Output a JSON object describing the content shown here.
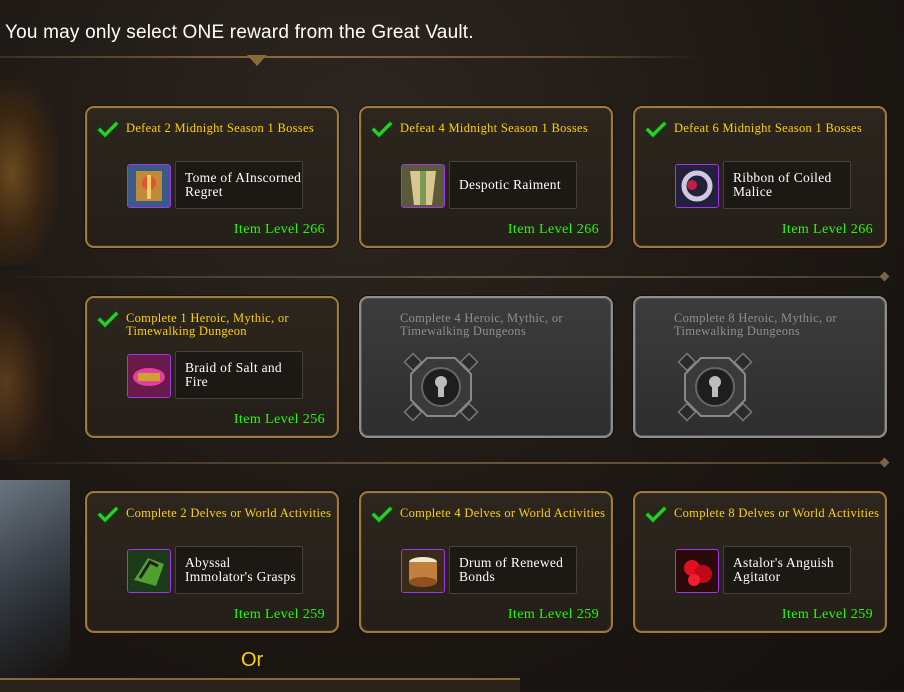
{
  "header": {
    "text": "You may only select ONE reward from the Great Vault."
  },
  "rows": [
    {
      "cards": [
        {
          "title": "Defeat 2 Midnight Season 1 Bosses",
          "item_name": "Tome of AInscorned Regret",
          "item_level": "Item Level 266",
          "icon": "tome-icon"
        },
        {
          "title": "Defeat 4 Midnight Season 1 Bosses",
          "item_name": "Despotic Raiment",
          "item_level": "Item Level 266",
          "icon": "robe-icon"
        },
        {
          "title": "Defeat 6 Midnight Season 1 Bosses",
          "item_name": "Ribbon of Coiled Malice",
          "item_level": "Item Level 266",
          "icon": "ring-icon"
        }
      ]
    },
    {
      "cards": [
        {
          "title": "Complete 1 Heroic, Mythic, or Timewalking Dungeon",
          "item_name": "Braid of Salt and Fire",
          "item_level": "Item Level 256",
          "icon": "belt-icon"
        },
        {
          "title": "Complete 4 Heroic, Mythic, or Timewalking Dungeons",
          "locked": true
        },
        {
          "title": "Complete 8 Heroic, Mythic, or Timewalking Dungeons",
          "locked": true
        }
      ]
    },
    {
      "cards": [
        {
          "title": "Complete 2 Delves or World Activities",
          "item_name": "Abyssal Immolator's Grasps",
          "item_level": "Item Level 259",
          "icon": "gauntlets-icon"
        },
        {
          "title": "Complete 4 Delves or World Activities",
          "item_name": "Drum of Renewed Bonds",
          "item_level": "Item Level 259",
          "icon": "drum-icon"
        },
        {
          "title": "Complete 8 Delves or World Activities",
          "item_name": "Astalor's Anguish Agitator",
          "item_level": "Item Level 259",
          "icon": "gem-icon"
        }
      ]
    }
  ],
  "or_label": "Or",
  "colors": {
    "title": "#ffd100",
    "item_level": "#1eff00",
    "epic_border": "#a335ee",
    "locked_text": "#8f8f8f"
  }
}
